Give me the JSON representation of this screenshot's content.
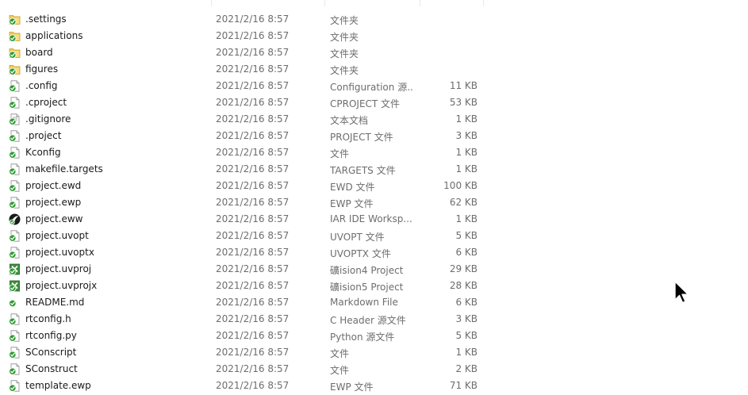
{
  "files": [
    {
      "name": ".settings",
      "date": "2021/2/16 8:57",
      "type": "文件夹",
      "size": "",
      "icon": "folder-sync-icon"
    },
    {
      "name": "applications",
      "date": "2021/2/16 8:57",
      "type": "文件夹",
      "size": "",
      "icon": "folder-sync-icon"
    },
    {
      "name": "board",
      "date": "2021/2/16 8:57",
      "type": "文件夹",
      "size": "",
      "icon": "folder-sync-icon"
    },
    {
      "name": "figures",
      "date": "2021/2/16 8:57",
      "type": "文件夹",
      "size": "",
      "icon": "folder-sync-icon"
    },
    {
      "name": ".config",
      "date": "2021/2/16 8:57",
      "type": "Configuration 源...",
      "size": "11 KB",
      "icon": "file-sync-icon"
    },
    {
      "name": ".cproject",
      "date": "2021/2/16 8:57",
      "type": "CPROJECT 文件",
      "size": "53 KB",
      "icon": "file-sync-icon"
    },
    {
      "name": ".gitignore",
      "date": "2021/2/16 8:57",
      "type": "文本文档",
      "size": "1 KB",
      "icon": "text-file-sync-icon"
    },
    {
      "name": ".project",
      "date": "2021/2/16 8:57",
      "type": "PROJECT 文件",
      "size": "3 KB",
      "icon": "file-sync-icon"
    },
    {
      "name": "Kconfig",
      "date": "2021/2/16 8:57",
      "type": "文件",
      "size": "1 KB",
      "icon": "file-sync-icon"
    },
    {
      "name": "makefile.targets",
      "date": "2021/2/16 8:57",
      "type": "TARGETS 文件",
      "size": "1 KB",
      "icon": "file-sync-icon"
    },
    {
      "name": "project.ewd",
      "date": "2021/2/16 8:57",
      "type": "EWD 文件",
      "size": "100 KB",
      "icon": "file-sync-icon"
    },
    {
      "name": "project.ewp",
      "date": "2021/2/16 8:57",
      "type": "EWP 文件",
      "size": "62 KB",
      "icon": "file-sync-icon"
    },
    {
      "name": "project.eww",
      "date": "2021/2/16 8:57",
      "type": "IAR IDE Worksp...",
      "size": "1 KB",
      "icon": "iar-workspace-icon"
    },
    {
      "name": "project.uvopt",
      "date": "2021/2/16 8:57",
      "type": "UVOPT 文件",
      "size": "5 KB",
      "icon": "file-sync-icon"
    },
    {
      "name": "project.uvoptx",
      "date": "2021/2/16 8:57",
      "type": "UVOPTX 文件",
      "size": "6 KB",
      "icon": "file-sync-icon"
    },
    {
      "name": "project.uvproj",
      "date": "2021/2/16 8:57",
      "type": "礦ision4 Project",
      "size": "29 KB",
      "icon": "keil-project-icon"
    },
    {
      "name": "project.uvprojx",
      "date": "2021/2/16 8:57",
      "type": "礦ision5 Project",
      "size": "28 KB",
      "icon": "keil-project-icon"
    },
    {
      "name": "README.md",
      "date": "2021/2/16 8:57",
      "type": "Markdown File",
      "size": "6 KB",
      "icon": "markdown-sync-icon"
    },
    {
      "name": "rtconfig.h",
      "date": "2021/2/16 8:57",
      "type": "C Header 源文件",
      "size": "3 KB",
      "icon": "file-sync-icon"
    },
    {
      "name": "rtconfig.py",
      "date": "2021/2/16 8:57",
      "type": "Python 源文件",
      "size": "5 KB",
      "icon": "file-sync-icon"
    },
    {
      "name": "SConscript",
      "date": "2021/2/16 8:57",
      "type": "文件",
      "size": "1 KB",
      "icon": "file-sync-icon"
    },
    {
      "name": "SConstruct",
      "date": "2021/2/16 8:57",
      "type": "文件",
      "size": "2 KB",
      "icon": "file-sync-icon"
    },
    {
      "name": "template.ewp",
      "date": "2021/2/16 8:57",
      "type": "EWP 文件",
      "size": "71 KB",
      "icon": "file-sync-icon"
    }
  ],
  "colors": {
    "sync_green": "#2e9b33",
    "folder_yellow": "#f2c84b",
    "name_text": "#1a1a1a",
    "detail_text": "#6d6d6d"
  }
}
